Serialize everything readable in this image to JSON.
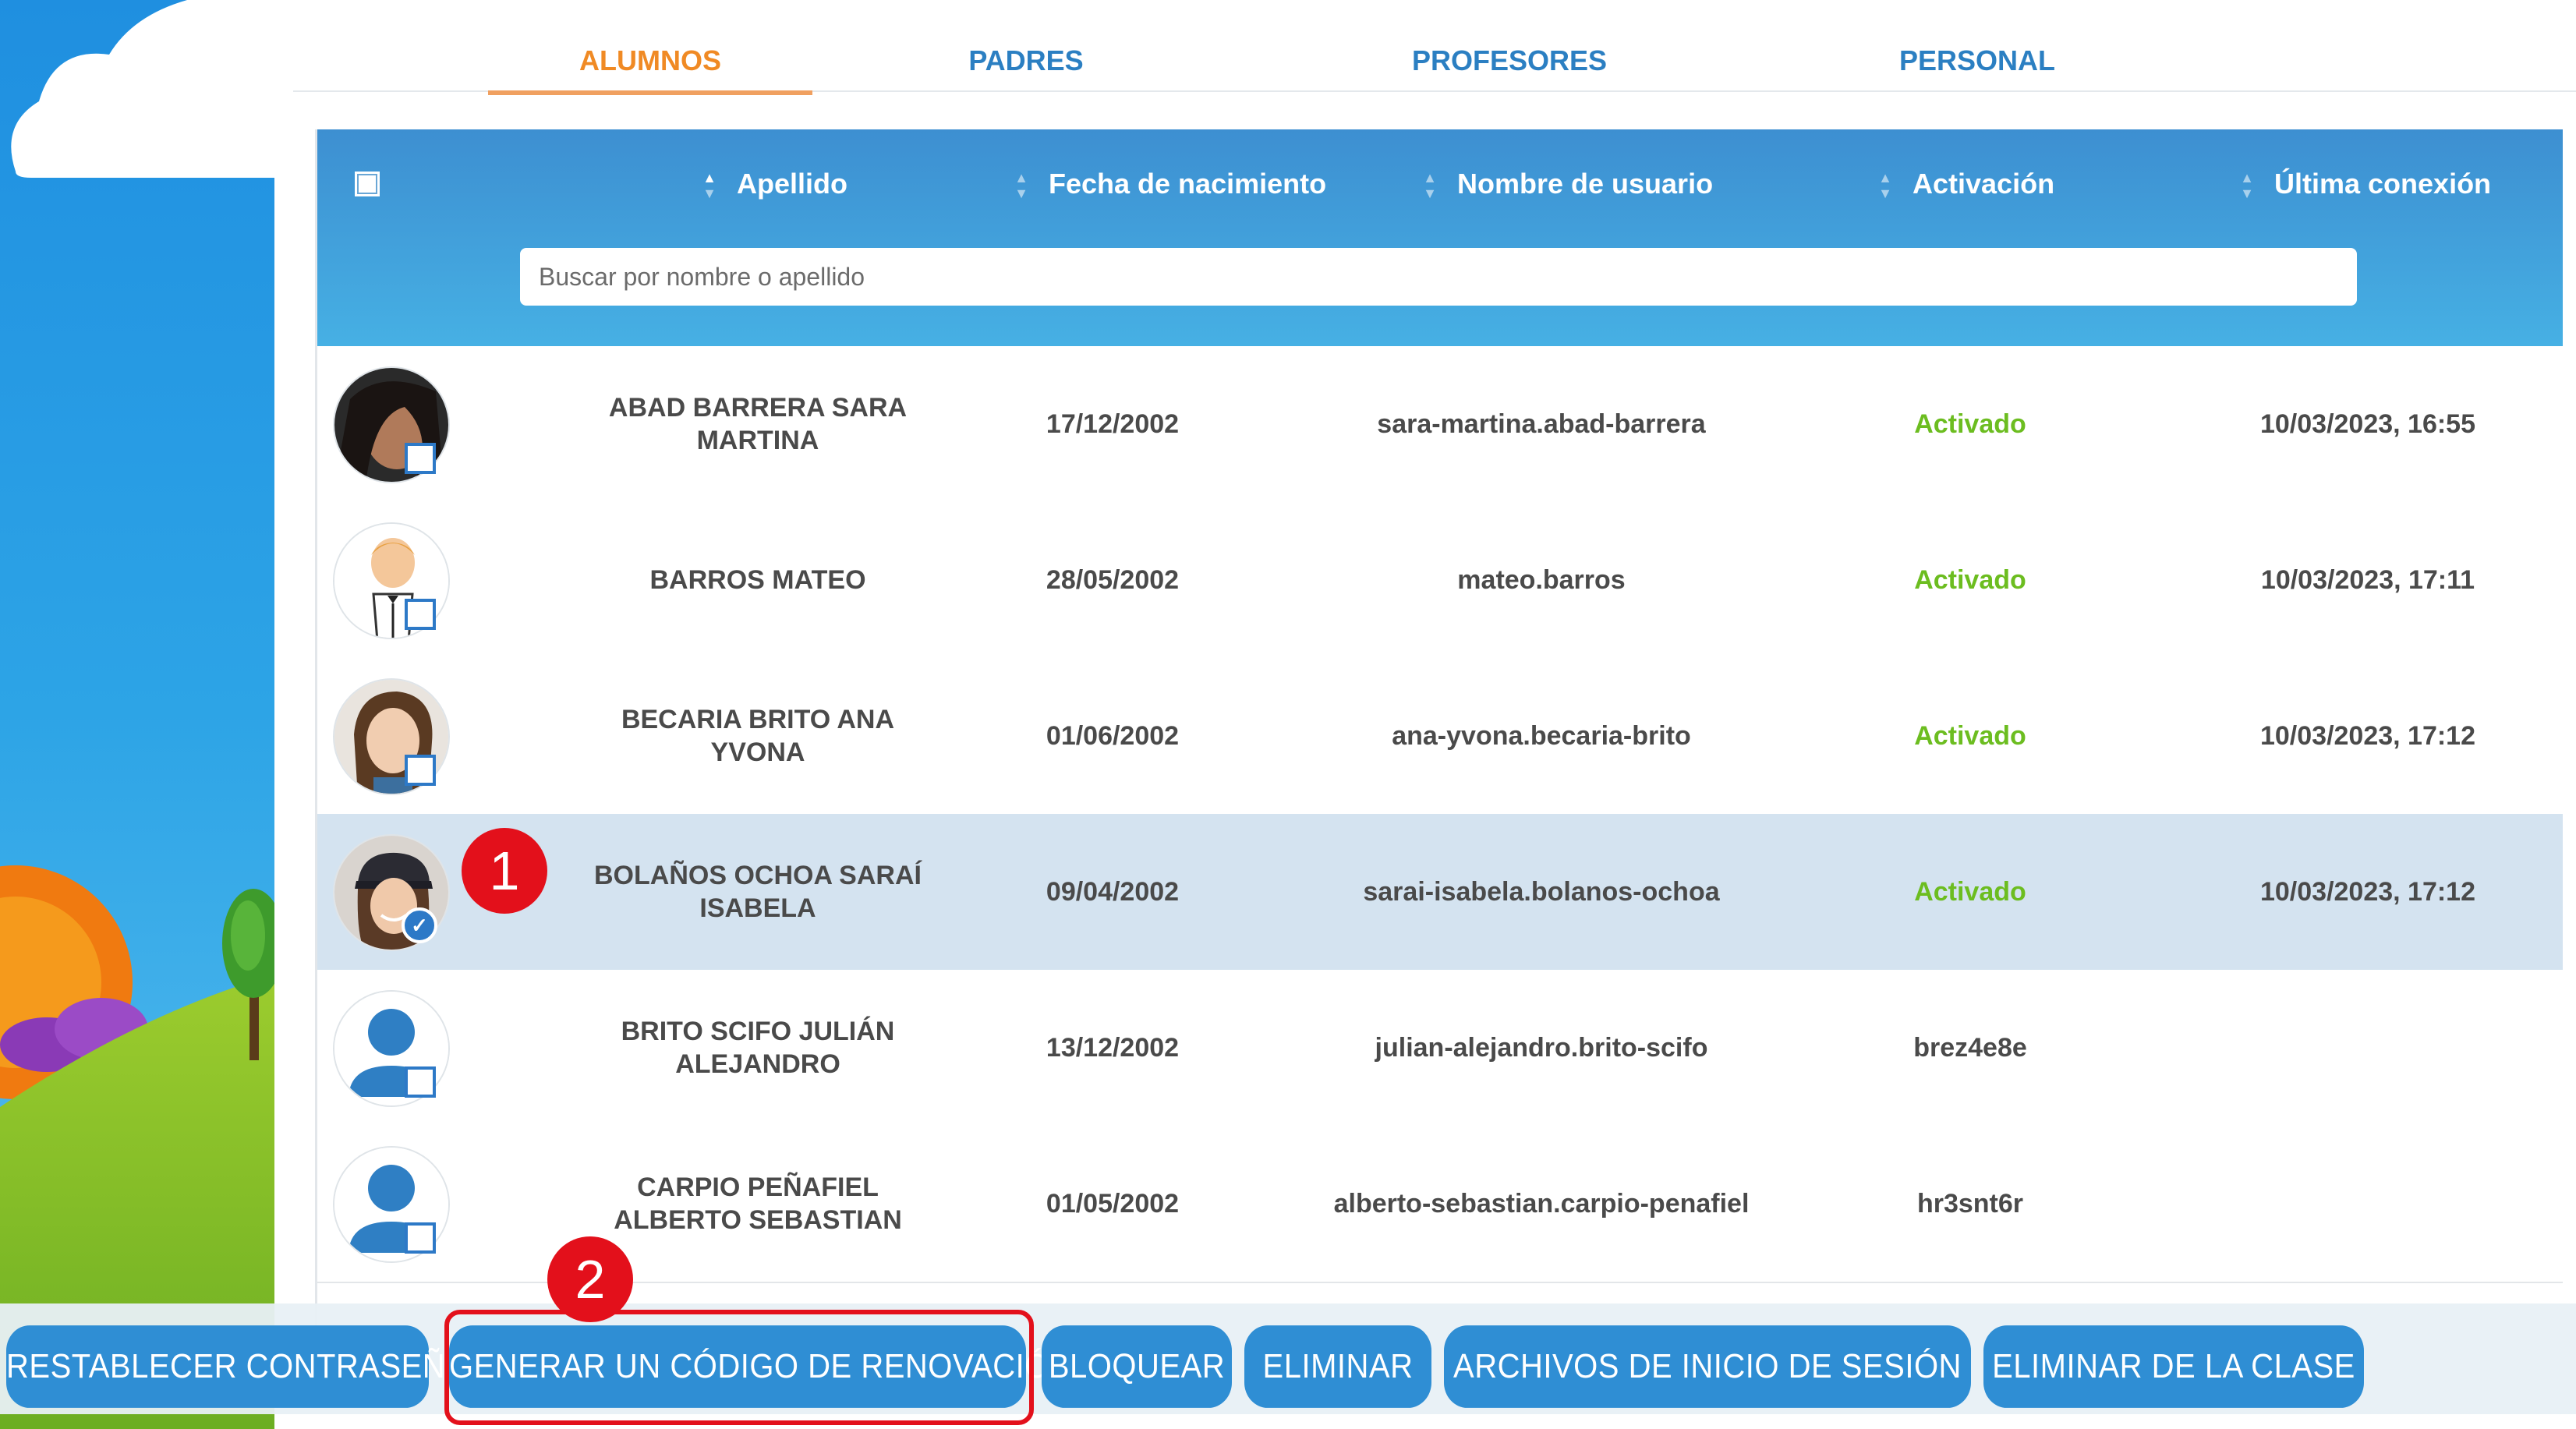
{
  "tabs": [
    {
      "label": "ALUMNOS",
      "active": true
    },
    {
      "label": "PADRES",
      "active": false
    },
    {
      "label": "PROFESORES",
      "active": false
    },
    {
      "label": "PERSONAL",
      "active": false
    }
  ],
  "table": {
    "columns": [
      "Apellido",
      "Fecha de nacimiento",
      "Nombre de usuario",
      "Activación",
      "Última conexión"
    ],
    "search_placeholder": "Buscar por nombre o apellido",
    "rows": [
      {
        "name": "ABAD BARRERA SARA MARTINA",
        "birth": "17/12/2002",
        "username": "sara-martina.abad-barrera",
        "activation": "Activado",
        "last": "10/03/2023, 16:55",
        "selected": false,
        "avatar": "photo-woman-dark-hair"
      },
      {
        "name": "BARROS MATEO",
        "birth": "28/05/2002",
        "username": "mateo.barros",
        "activation": "Activado",
        "last": "10/03/2023, 17:11",
        "selected": false,
        "avatar": "cartoon-man-tuxedo"
      },
      {
        "name": "BECARIA BRITO ANA YVONA",
        "birth": "01/06/2002",
        "username": "ana-yvona.becaria-brito",
        "activation": "Activado",
        "last": "10/03/2023, 17:12",
        "selected": false,
        "avatar": "photo-woman-red-hair"
      },
      {
        "name": "BOLAÑOS OCHOA SARAÍ ISABELA",
        "birth": "09/04/2002",
        "username": "sarai-isabela.bolanos-ochoa",
        "activation": "Activado",
        "last": "10/03/2023, 17:12",
        "selected": true,
        "avatar": "photo-girl-cap"
      },
      {
        "name": "BRITO SCIFO JULIÁN ALEJANDRO",
        "birth": "13/12/2002",
        "username": "julian-alejandro.brito-scifo",
        "activation": "brez4e8e",
        "last": "",
        "selected": false,
        "avatar": "default-user-icon"
      },
      {
        "name": "CARPIO PEÑAFIEL ALBERTO SEBASTIAN",
        "birth": "01/05/2002",
        "username": "alberto-sebastian.carpio-penafiel",
        "activation": "hr3snt6r",
        "last": "",
        "selected": false,
        "avatar": "default-user-icon"
      }
    ]
  },
  "markers": {
    "one": "1",
    "two": "2"
  },
  "toolbar": {
    "reset_password": "RESTABLECER CONTRASEÑA",
    "renewal_code": "GENERAR UN CÓDIGO DE RENOVACIÓN",
    "block": "BLOQUEAR",
    "delete": "ELIMINAR",
    "login_files": "ARCHIVOS DE INICIO DE SESIÓN",
    "remove_from_class": "ELIMINAR DE LA CLASE"
  },
  "colors": {
    "accent_orange": "#f08a24",
    "tab_blue": "#2b7fc2",
    "header_blue": "#3d8fd1",
    "button_blue": "#2f8ed4",
    "activated_green": "#6cbd20",
    "selected_row": "#d4e3f0",
    "annotation_red": "#e3101b"
  }
}
